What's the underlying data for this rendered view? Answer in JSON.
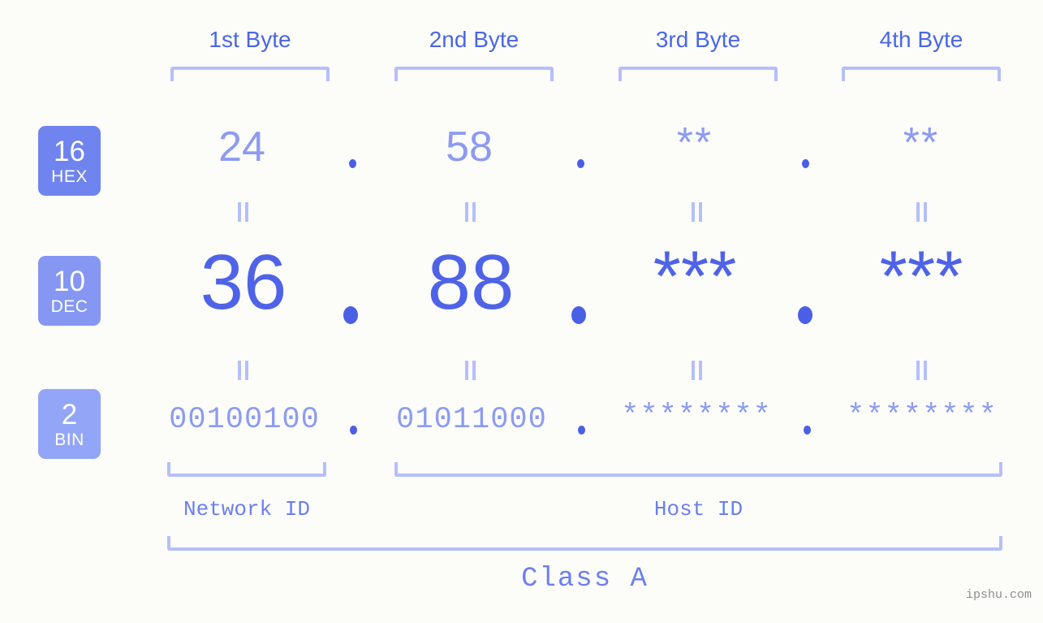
{
  "background_color": "#fcfdf9",
  "accent_strong": "#4f63e8",
  "accent_light": "#8c9bf2",
  "bracket_color": "#b5bffa",
  "headers": [
    {
      "label": "1st Byte"
    },
    {
      "label": "2nd Byte"
    },
    {
      "label": "3rd Byte"
    },
    {
      "label": "4th Byte"
    }
  ],
  "bases": [
    {
      "number": "16",
      "name": "HEX",
      "color": "#7084ef"
    },
    {
      "number": "10",
      "name": "DEC",
      "color": "#8597f2"
    },
    {
      "number": "2",
      "name": "BIN",
      "color": "#93a5f7"
    }
  ],
  "rows": {
    "hex": {
      "base": "16",
      "base_name": "HEX",
      "values": [
        "24",
        "58",
        "**",
        "**"
      ]
    },
    "dec": {
      "base": "10",
      "base_name": "DEC",
      "values": [
        "36",
        "88",
        "***",
        "***"
      ]
    },
    "bin": {
      "base": "2",
      "base_name": "BIN",
      "values": [
        "00100100",
        "01011000",
        "********",
        "********"
      ]
    }
  },
  "separator": ".",
  "equals_mark": "=",
  "segments": {
    "network_id": "Network ID",
    "host_id": "Host ID",
    "class": "Class A"
  },
  "watermark": "ipshu.com"
}
